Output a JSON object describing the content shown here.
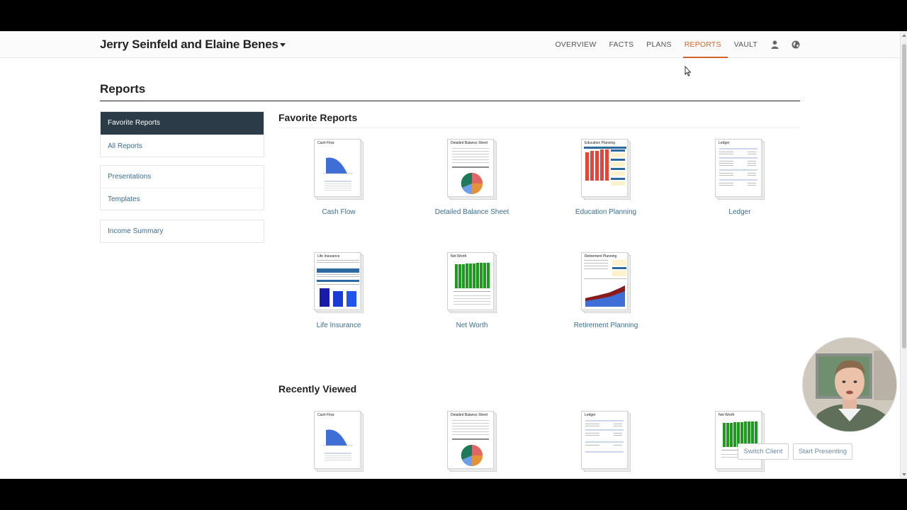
{
  "client": {
    "name": "Jerry Seinfeld and Elaine Benes"
  },
  "nav": {
    "items": [
      {
        "label": "OVERVIEW",
        "active": false
      },
      {
        "label": "FACTS",
        "active": false
      },
      {
        "label": "PLANS",
        "active": false
      },
      {
        "label": "REPORTS",
        "active": true
      },
      {
        "label": "VAULT",
        "active": false
      }
    ],
    "icons": [
      "user-icon",
      "globe-icon"
    ],
    "accent_color": "#d0652a"
  },
  "page": {
    "title": "Reports"
  },
  "sidebar": {
    "groups": [
      {
        "items": [
          {
            "label": "Favorite Reports",
            "active": true
          },
          {
            "label": "All Reports",
            "active": false
          }
        ]
      },
      {
        "items": [
          {
            "label": "Presentations",
            "active": false
          },
          {
            "label": "Templates",
            "active": false
          }
        ]
      },
      {
        "items": [
          {
            "label": "Income Summary",
            "active": false
          }
        ]
      }
    ]
  },
  "favorites": {
    "title": "Favorite Reports",
    "reports": [
      {
        "label": "Cash Flow",
        "thumb_title": "Cash Flow"
      },
      {
        "label": "Detailed Balance Sheet",
        "thumb_title": "Detailed Balance Sheet"
      },
      {
        "label": "Education Planning",
        "thumb_title": "Education Planning"
      },
      {
        "label": "Ledger",
        "thumb_title": "Ledger"
      },
      {
        "label": "Life Insurance",
        "thumb_title": "Life Insurance"
      },
      {
        "label": "Net Worth",
        "thumb_title": "Net Worth"
      },
      {
        "label": "Retirement Planning",
        "thumb_title": "Retirement Planning"
      }
    ]
  },
  "recent": {
    "title": "Recently Viewed",
    "reports": [
      {
        "thumb_title": "Cash Flow"
      },
      {
        "thumb_title": "Detailed Balance Sheet"
      },
      {
        "thumb_title": "Ledger"
      },
      {
        "thumb_title": "Net Worth"
      }
    ]
  },
  "buttons": {
    "switch_client": "Switch Client",
    "start_presenting": "Start Presenting"
  },
  "colors": {
    "sidebar_active_bg": "#2b3b47",
    "link": "#3a6d93",
    "chart_blue": "#3f6fd6",
    "chart_green": "#1e9a1e",
    "chart_red": "#e0463a"
  }
}
